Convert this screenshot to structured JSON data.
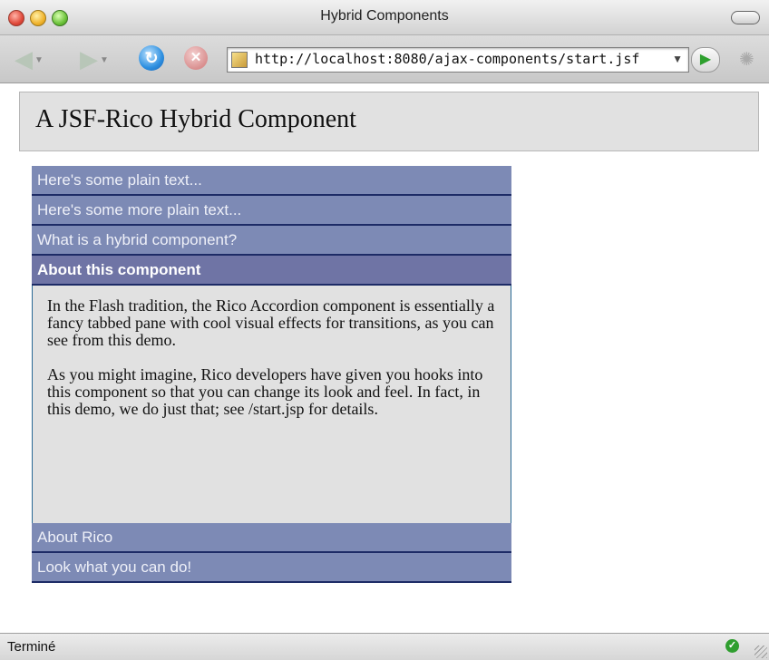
{
  "window": {
    "title": "Hybrid Components"
  },
  "toolbar": {
    "url": "http://localhost:8080/ajax-components/start.jsf"
  },
  "page": {
    "heading": "A JSF-Rico Hybrid Component",
    "accordion": {
      "tabs_before": [
        "Here's some plain text...",
        "Here's some more plain text...",
        "What is a hybrid component?"
      ],
      "active_tab": "About this component",
      "active_content": [
        "In the Flash tradition, the Rico Accordion component is essentially a fancy tabbed pane with cool visual effects for transitions, as you can see from this demo.",
        "As you might imagine, Rico developers have given you hooks into this component so that you can change its look and feel. In fact, in this demo, we do just that; see /start.jsp for details."
      ],
      "tabs_after": [
        "About Rico",
        "Look what you can do!"
      ]
    }
  },
  "statusbar": {
    "text": "Terminé"
  },
  "icons": {
    "back": "back-arrow-icon",
    "forward": "forward-arrow-icon",
    "reload": "reload-icon",
    "stop": "stop-icon",
    "go": "go-icon",
    "status": "secure-ok-icon"
  },
  "colors": {
    "tab_bg": "#7d8ab5",
    "active_tab_bg": "#6f74a5",
    "panel_bg": "#e1e1e1",
    "tab_border": "#1d2b66"
  }
}
